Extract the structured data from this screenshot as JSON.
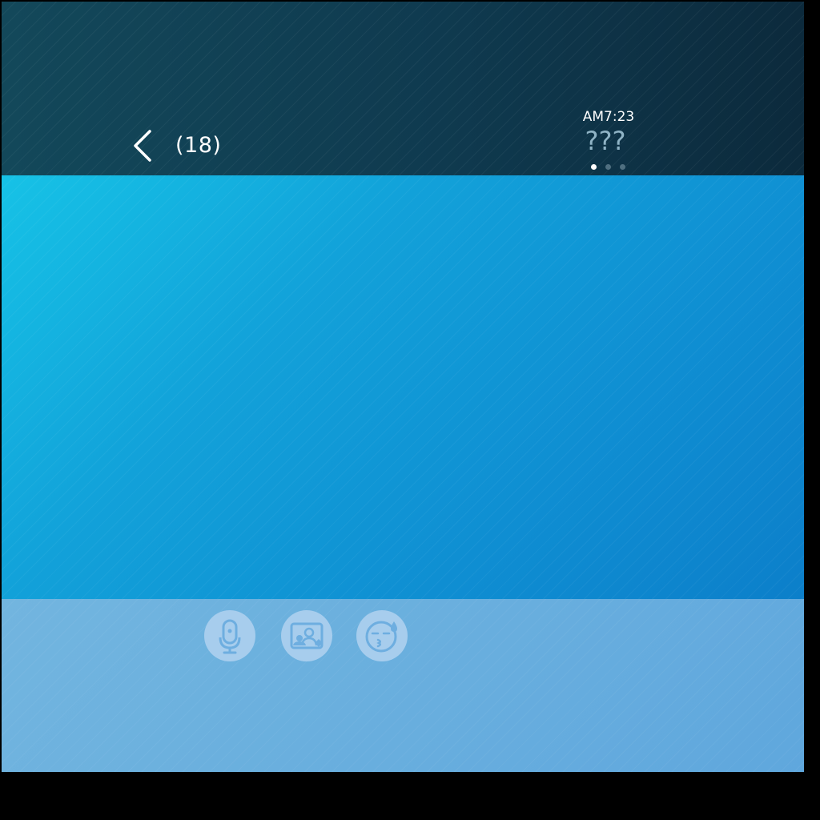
{
  "header": {
    "back_icon": "chevron-left-icon",
    "count": "(18)",
    "time": "AM7:23",
    "title": "???",
    "page_dots": [
      {
        "active": true
      },
      {
        "active": false
      },
      {
        "active": false
      }
    ]
  },
  "toolbar": {
    "items": [
      {
        "name": "voice-input-button",
        "icon": "microphone-icon"
      },
      {
        "name": "photo-button",
        "icon": "photo-icon"
      },
      {
        "name": "emoji-button",
        "icon": "emoji-icon"
      }
    ]
  },
  "colors": {
    "header_bg": "#0f3a4f",
    "main_bg": "#12a1d9",
    "bottom_bg": "#68aede",
    "tool_bg": "#a7cded",
    "icon_color": "#6eaee0"
  }
}
